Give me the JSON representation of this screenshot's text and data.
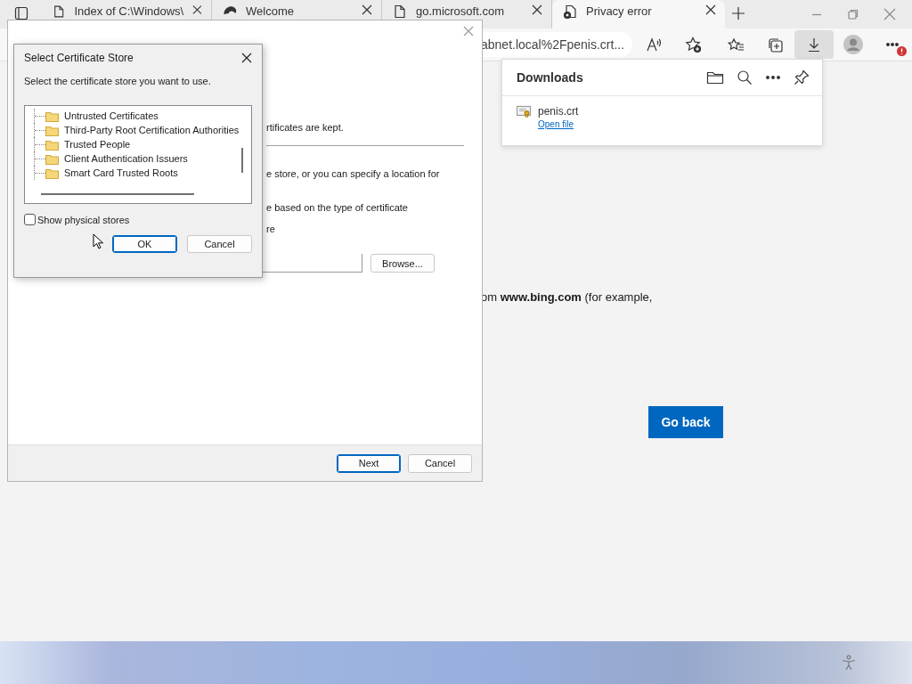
{
  "browser": {
    "tabs": [
      {
        "title": "Index of C:\\Windows\\",
        "kind": "page",
        "selected": false
      },
      {
        "title": "Welcome",
        "kind": "edge",
        "selected": false
      },
      {
        "title": "go.microsoft.com",
        "kind": "page",
        "selected": false
      },
      {
        "title": "Privacy error",
        "kind": "error",
        "selected": true
      }
    ],
    "address": "abnet.local%2Fpenis.crt...",
    "downloads_button": {
      "selected": true
    },
    "menu_alert": true
  },
  "downloads_panel": {
    "title": "Downloads",
    "items": [
      {
        "file": "penis.crt",
        "action": "Open file"
      }
    ]
  },
  "page": {
    "text": "om **www.bing.com** (for example,",
    "button": "Go back"
  },
  "wizard": {
    "lines": [
      "rtificates are kept.",
      "e store, or you can specify a location for",
      "e based on the type of certificate",
      "re"
    ],
    "browse": "Browse...",
    "buttons": [
      {
        "label": "Next",
        "default": true
      },
      {
        "label": "Cancel",
        "default": false
      }
    ]
  },
  "dialog": {
    "title": "Select Certificate Store",
    "prompt": "Select the certificate store you want to use.",
    "stores": [
      {
        "name": "Untrusted Certificates",
        "selected": false
      },
      {
        "name": "Third-Party Root Certification Authorities",
        "selected": false
      },
      {
        "name": "Trusted People",
        "selected": false
      },
      {
        "name": "Client Authentication Issuers",
        "selected": false
      },
      {
        "name": "Smart Card Trusted Roots",
        "selected": false
      }
    ],
    "show_physical": {
      "label": "Show physical stores",
      "checked": false
    },
    "buttons": [
      {
        "label": "OK",
        "default": true
      },
      {
        "label": "Cancel",
        "default": false
      }
    ]
  }
}
